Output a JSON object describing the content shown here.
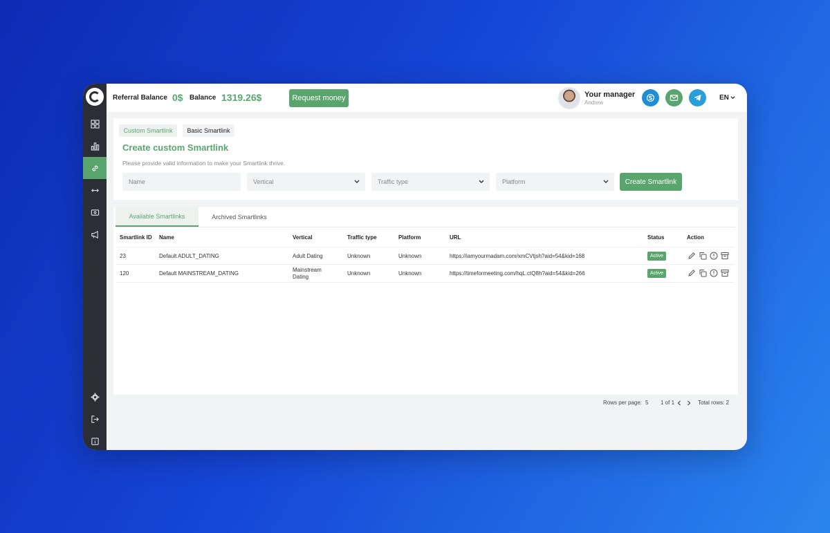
{
  "topbar": {
    "referral_label": "Referral Balance",
    "referral_value": "0$",
    "balance_label": "Balance",
    "balance_value": "1319.26$",
    "request_button": "Request money",
    "manager_title": "Your manager",
    "manager_name": "Andrew",
    "language": "EN"
  },
  "sidebar": {
    "items": [
      {
        "icon": "dashboard-icon"
      },
      {
        "icon": "statistics-icon"
      },
      {
        "icon": "link-icon",
        "active": true
      },
      {
        "icon": "arrows-icon"
      },
      {
        "icon": "payment-icon"
      },
      {
        "icon": "megaphone-icon"
      }
    ],
    "bottom": [
      {
        "icon": "gear-icon"
      },
      {
        "icon": "logout-icon"
      },
      {
        "icon": "info-icon"
      }
    ]
  },
  "form": {
    "tabs": [
      "Custom Smartlink",
      "Basic Smartlink"
    ],
    "title": "Create custom Smartlink",
    "description": "Please provide valid information to make your Smartlink thrive.",
    "name_placeholder": "Name",
    "vertical_placeholder": "Vertical",
    "traffic_placeholder": "Traffic type",
    "platform_placeholder": "Platform",
    "create_button": "Create Smartlink"
  },
  "list": {
    "tabs": [
      "Available Smartlinks",
      "Archived Smartlinks"
    ],
    "columns": [
      "Smartlink ID",
      "Name",
      "Vertical",
      "Traffic type",
      "Platform",
      "URL",
      "Status",
      "Action"
    ],
    "rows": [
      {
        "id": "23",
        "name": "Default ADULT_DATING",
        "vertical": "Adult Dating",
        "vertical2": "",
        "traffic": "Unknown",
        "platform": "Unknown",
        "url": "https://iamyourmadam.com/xmCVtjsh?aid=54&kid=168",
        "status": "Active"
      },
      {
        "id": "120",
        "name": "Default MAINSTREAM_DATING",
        "vertical": "Mainstream",
        "vertical2": "Dating",
        "traffic": "Unknown",
        "platform": "Unknown",
        "url": "https://timeformeeting.com/hqL.ctQ8h?aid=54&kid=266",
        "status": "Active"
      }
    ]
  },
  "pagination": {
    "rows_label": "Rows per page:",
    "rows_value": "5",
    "page_info": "1 of 1",
    "total": "Total rows: 2"
  },
  "colors": {
    "accent": "#5aa56e",
    "sidebar": "#2b2e34",
    "skype": "#1e8fd6",
    "mail": "#5aa56e",
    "telegram": "#2a9ed8"
  }
}
